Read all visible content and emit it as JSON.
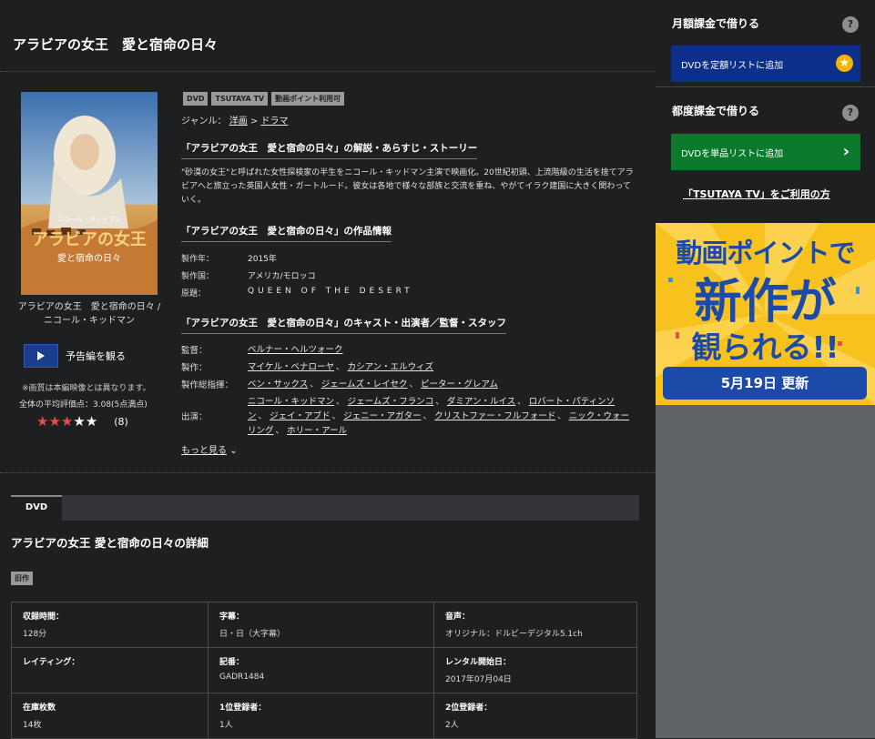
{
  "page": {
    "title": "アラビアの女王　愛と宿命の日々"
  },
  "poster": {
    "caption": "アラビアの女王　愛と宿命の日々 / ニコール・キッドマン",
    "art_title_lines": [
      "アラビアの女王",
      "愛と宿命の日々"
    ],
    "art_actor": "ニコール・キッドマン"
  },
  "trailer": {
    "label": "予告編を観る"
  },
  "quality_note": "※画質は本編映像とは異なります。",
  "rating": {
    "average_text": "全体の平均評価点：3.08(5点満点)",
    "value": 3.08,
    "stars_filled": 3,
    "stars_total": 5,
    "review_count": "(8)"
  },
  "badges": [
    "DVD",
    "TSUTAYA TV",
    "動画ポイント利用可"
  ],
  "genre": {
    "label": "ジャンル：",
    "parent": "洋画",
    "sep": ">",
    "child": "ドラマ"
  },
  "synopsis": {
    "heading": "「アラビアの女王　愛と宿命の日々」の解説・あらすじ・ストーリー",
    "text": "\"砂漠の女王\"と呼ばれた女性探検家の半生をニコール・キッドマン主演で映画化。20世紀初頭、上流階級の生活を捨てアラビアへと旅立った英国人女性・ガートルード。彼女は各地で様々な部族と交流を重ね、やがてイラク建国に大きく関わっていく。"
  },
  "work_info": {
    "heading": "「アラビアの女王　愛と宿命の日々」の作品情報",
    "rows": [
      {
        "k": "製作年：",
        "v": "2015年"
      },
      {
        "k": "製作国：",
        "v": "アメリカ/モロッコ"
      },
      {
        "k": "原題：",
        "v": "QUEEN OF THE DESERT"
      }
    ]
  },
  "cast": {
    "heading": "「アラビアの女王　愛と宿命の日々」のキャスト・出演者／監督・スタッフ",
    "director": {
      "k": "監督：",
      "names": [
        "ベルナー・ヘルツォーク"
      ]
    },
    "producer": {
      "k": "製作：",
      "names": [
        "マイケル・ベナローヤ",
        "カシアン・エルウィズ"
      ]
    },
    "exec": {
      "k": "製作総指揮：",
      "names": [
        "ベン・サックス",
        "ジェームズ・レイセク",
        "ピーター・グレアム"
      ]
    },
    "actors": {
      "k": "出演：",
      "names": [
        "ニコール・キッドマン",
        "ジェームズ・フランコ",
        "ダミアン・ルイス",
        "ロバート・パティンソン",
        "ジェイ・アブド",
        "ジェニー・アガター",
        "クリストファー・フルフォード",
        "ニック・ウォーリング",
        "ホリー・アール"
      ]
    },
    "separator": "、"
  },
  "more": {
    "label": "もっと見る",
    "chevron": "⌄"
  },
  "dvd_section": {
    "tab": "DVD",
    "detail_title": "アラビアの女王 愛と宿命の日々の詳細",
    "old_badge": "旧作",
    "table": [
      [
        {
          "label": "収録時間：",
          "value": "128分"
        },
        {
          "label": "字幕：",
          "value": "日・日（大字幕）"
        },
        {
          "label": "音声：",
          "value": "オリジナル：ドルビーデジタル5.1ch"
        }
      ],
      [
        {
          "label": "レイティング：",
          "value": ""
        },
        {
          "label": "記番：",
          "value": "GADR1484"
        },
        {
          "label": "レンタル開始日：",
          "value": "2017年07月04日"
        }
      ],
      [
        {
          "label": "在庫枚数",
          "value": "14枚"
        },
        {
          "label": "1位登録者：",
          "value": "1人"
        },
        {
          "label": "2位登録者：",
          "value": "2人"
        }
      ]
    ]
  },
  "sidebar": {
    "monthly": {
      "heading": "月額課金で借りる",
      "help": "?",
      "button": "DVDを定額リストに追加",
      "icon": "★"
    },
    "single": {
      "heading": "都度課金で借りる",
      "help": "?",
      "button": "DVDを単品リストに追加",
      "icon": "›"
    },
    "tsutaya_link": "「TSUTAYA TV」をご利用の方",
    "banner": {
      "line1": "動画ポイントで",
      "line2": "新作が",
      "line3": "観られる!!",
      "update": "5月19日 更新"
    },
    "colors": {
      "monthly_button": "#0b2f8a",
      "single_button": "#0c7a2d",
      "banner_bg": "#f7c21e",
      "star_on": "#e94e46"
    }
  }
}
